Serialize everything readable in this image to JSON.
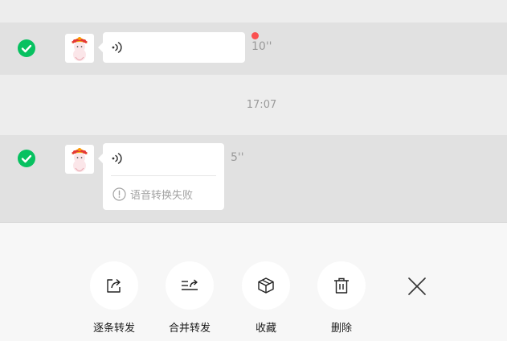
{
  "messages": [
    {
      "selected": true,
      "duration": "10''",
      "unread": true,
      "transcription_status": ""
    },
    {
      "selected": true,
      "duration": "5''",
      "unread": false,
      "transcription_status": "语音转换失败"
    }
  ],
  "time_separator": "17:07",
  "actions": {
    "forward_each": "逐条转发",
    "forward_merge": "合并转发",
    "favorite": "收藏",
    "delete": "删除"
  },
  "icons": {
    "check": "checkmark-circle-icon",
    "voice": "voice-wave-icon",
    "warning": "exclamation-circle-icon",
    "forward_each": "share-arrow-icon",
    "forward_merge": "merge-forward-icon",
    "favorite": "cube-box-icon",
    "delete": "trash-icon",
    "close": "close-icon"
  },
  "colors": {
    "check_green": "#07c160",
    "unread_red": "#fa5151",
    "selected_row": "#e1e1e1",
    "background": "#ededed",
    "toolbar": "#f7f7f7"
  }
}
